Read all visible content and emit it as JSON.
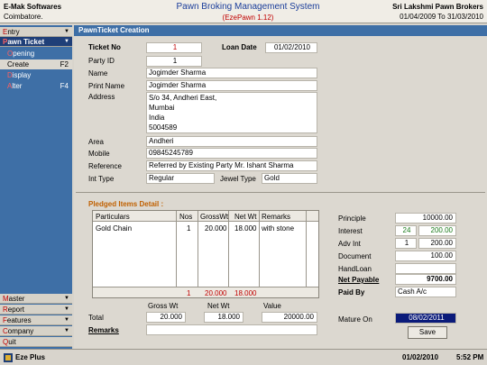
{
  "header": {
    "company": "E-Mak Softwares",
    "city": "Coimbatore.",
    "title": "Pawn Broking Management System",
    "subtitle": "(EzePawn 1.12)",
    "firm": "Sri Lakshmi Pawn Brokers",
    "period": "01/04/2009 To 31/03/2010"
  },
  "nav": {
    "entry": {
      "hot": "E",
      "rest": "ntry"
    },
    "pawn_ticket": {
      "hot": "P",
      "rest": "awn Ticket"
    },
    "opening": {
      "hot": "O",
      "rest": "pening"
    },
    "create": {
      "text": "Create",
      "key": "F2"
    },
    "display": {
      "hot": "D",
      "rest": "isplay"
    },
    "alter": {
      "hot": "A",
      "rest": "lter",
      "key": "F4"
    },
    "master": {
      "hot": "M",
      "rest": "aster"
    },
    "report": {
      "hot": "R",
      "rest": "eport"
    },
    "features": {
      "hot": "F",
      "rest": "eatures"
    },
    "company": {
      "hot": "C",
      "rest": "ompany"
    },
    "quit": {
      "hot": "Q",
      "rest": "uit"
    }
  },
  "form": {
    "title": "PawnTicket Creation",
    "ticket_no_label": "Ticket No",
    "ticket_no": "1",
    "loan_date_label": "Loan Date",
    "loan_date": "01/02/2010",
    "party_id_label": "Party ID",
    "party_id": "1",
    "name_label": "Name",
    "name": "Jogimder Sharma",
    "print_name_label": "Print Name",
    "print_name": "Jogimder Sharma",
    "address_label": "Address",
    "address": [
      "S/o 34, Andheri East,",
      "Mumbai",
      "India",
      "5004589"
    ],
    "area_label": "Area",
    "area": "Andheri",
    "mobile_label": "Mobile",
    "mobile": "09845245789",
    "reference_label": "Reference",
    "reference": "Referred by Existing Party Mr. Ishant Sharma",
    "int_type_label": "Int Type",
    "int_type": "Regular",
    "jewel_type_label": "Jewel Type",
    "jewel_type": "Gold"
  },
  "pledged": {
    "title": "Pledged Items Detail :",
    "columns": [
      "Particulars",
      "Nos",
      "GrossWt",
      "Net Wt",
      "Remarks"
    ],
    "rows": [
      {
        "particulars": "Gold Chain",
        "nos": "1",
        "gross": "20.000",
        "net": "18.000",
        "remarks": "with stone"
      }
    ],
    "totals": {
      "nos": "1",
      "gross": "20.000",
      "net": "18.000"
    }
  },
  "summary": {
    "gross_label": "Gross Wt",
    "net_label": "Net Wt",
    "value_label": "Value",
    "total_label": "Total",
    "gross": "20.000",
    "net": "18.000",
    "value": "20000.00",
    "remarks_label": "Remarks",
    "remarks": ""
  },
  "loan": {
    "principle_label": "Principle",
    "principle": "10000.00",
    "interest_label": "Interest",
    "interest_rate": "24",
    "interest": "200.00",
    "adv_int_label": "Adv Int",
    "adv_int_months": "1",
    "adv_int": "200.00",
    "document_label": "Document",
    "document": "100.00",
    "handloan_label": "HandLoan",
    "handloan": "",
    "net_payable_label": "Net Payable",
    "net_payable": "9700.00",
    "paid_by_label": "Paid By",
    "paid_by": "Cash A/c",
    "mature_on_label": "Mature On",
    "mature_on": "08/02/2011",
    "save_label": "Save"
  },
  "status": {
    "app": "Eze Plus",
    "date": "01/02/2010",
    "time": "5:52 PM"
  }
}
